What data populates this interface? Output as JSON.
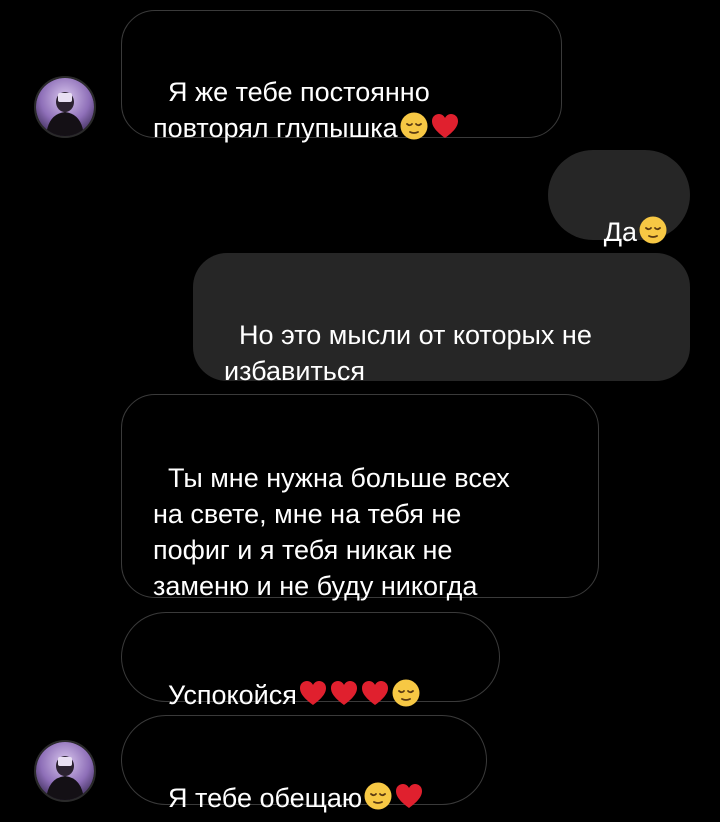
{
  "messages": [
    {
      "sender": "them",
      "text": "Я же тебе постоянно\nповторял глупышка",
      "emojis": [
        "pensive-face",
        "red-heart"
      ]
    },
    {
      "sender": "me",
      "text": "Да",
      "emojis": [
        "pensive-face"
      ]
    },
    {
      "sender": "me",
      "text": "Но это мысли от которых не\nизбавиться",
      "emojis": []
    },
    {
      "sender": "them",
      "text": "Ты мне нужна больше всех\nна свете, мне на тебя не\nпофиг и я тебя никак не\nзаменю и не буду никогда",
      "emojis": []
    },
    {
      "sender": "them",
      "text": "Успокойся",
      "emojis": [
        "red-heart",
        "red-heart",
        "red-heart",
        "pensive-face"
      ]
    },
    {
      "sender": "them",
      "text": "Я тебе обещаю",
      "emojis": [
        "pensive-face",
        "red-heart"
      ]
    }
  ],
  "colors": {
    "background": "#000000",
    "incoming_bubble_border": "#3a3a3a",
    "outgoing_bubble": "#262626",
    "text": "#ffffff",
    "heart": "#e0202e",
    "emoji_face": "#f7c844"
  }
}
